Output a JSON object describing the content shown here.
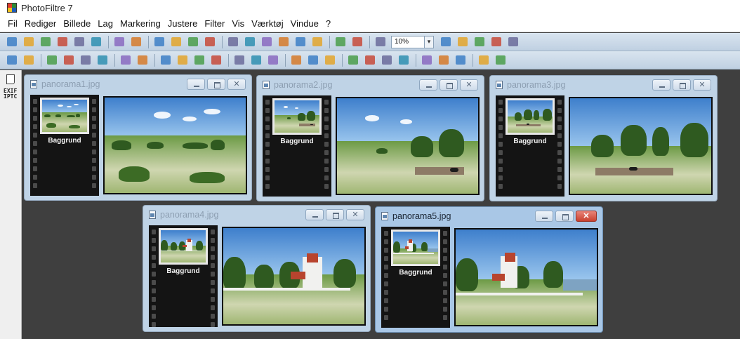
{
  "app": {
    "title": "PhotoFiltre 7"
  },
  "menu": [
    "Fil",
    "Rediger",
    "Billede",
    "Lag",
    "Markering",
    "Justere",
    "Filter",
    "Vis",
    "Værktøj",
    "Vindue",
    "?"
  ],
  "toolbar1": {
    "zoom_value": "10%",
    "icons": [
      "new-icon",
      "open-icon",
      "save-icon",
      "paste-icon",
      "print-icon",
      "scan-icon",
      "undo-icon",
      "redo-icon",
      "copy-icon",
      "copy-merged-icon",
      "paste-new-icon",
      "fill-icon",
      "grid-icon",
      "bg-icon",
      "image-size-icon",
      "canvas-size-icon",
      "select-icon",
      "text-icon",
      "layer-icon",
      "palette-icon",
      "browser-icon"
    ],
    "zoom_icons": [
      "zoom-in-icon",
      "zoom-out-icon",
      "fit-icon",
      "actual-size-icon",
      "fullscreen-icon"
    ]
  },
  "toolbar2": {
    "icons": [
      "magic-wand-icon",
      "lasso-icon",
      "brightness-down-icon",
      "brightness-up-icon",
      "contrast-down-icon",
      "contrast-up-icon",
      "saturation-down-icon",
      "saturation-up-icon",
      "gamma-icon",
      "levels-icon",
      "auto-levels-icon",
      "auto-contrast-icon",
      "mosaic-icon",
      "pixelize-icon",
      "emboss-icon",
      "blur-icon",
      "sharpen-icon",
      "drop-icon",
      "crop-icon",
      "red-eye-icon",
      "warm-icon",
      "cool-icon",
      "flip-icon",
      "rotate-icon",
      "mirror-icon",
      "frame-icon",
      "plugin-icon"
    ]
  },
  "left_panel": {
    "exif_label": "EXIF IPTC"
  },
  "windows": [
    {
      "title": "panorama1.jpg",
      "layer": "Baggrund",
      "active": false
    },
    {
      "title": "panorama2.jpg",
      "layer": "Baggrund",
      "active": false
    },
    {
      "title": "panorama3.jpg",
      "layer": "Baggrund",
      "active": false
    },
    {
      "title": "panorama4.jpg",
      "layer": "Baggrund",
      "active": false
    },
    {
      "title": "panorama5.jpg",
      "layer": "Baggrund",
      "active": true
    }
  ],
  "colors": {
    "workspace": "#3f3f3f",
    "toolbar": "#c9d8e8",
    "active_window": "#a9c7e6",
    "close_red": "#c9412f"
  }
}
